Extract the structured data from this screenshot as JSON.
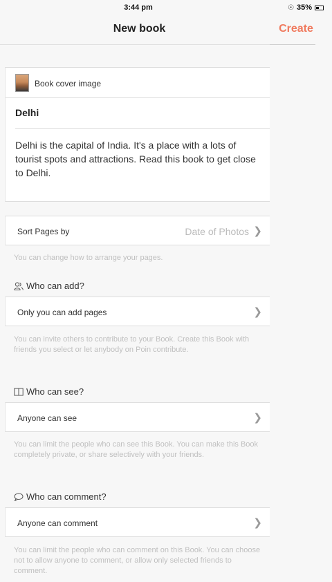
{
  "status_bar": {
    "time": "3:44 pm",
    "battery": "35%"
  },
  "nav": {
    "title": "New book",
    "create_label": "Create"
  },
  "book": {
    "cover_label": "Book cover image",
    "title": "Delhi",
    "description": "Delhi is the capital of India. It's a place with a lots of tourist spots and attractions. Read this book  to get close to Delhi."
  },
  "sort": {
    "label": "Sort Pages by",
    "value": "Date of Photos",
    "hint": "You can change how to arrange your pages."
  },
  "who_add": {
    "header": "Who can add?",
    "value": "Only you can add pages",
    "hint": "You can invite others to contribute to your Book. Create this Book with friends you select or let anybody on Poin contribute."
  },
  "who_see": {
    "header": "Who can see?",
    "value": "Anyone can see",
    "hint": "You can limit the people who can see this Book. You can make this Book completely private, or share selectively with your friends."
  },
  "who_comment": {
    "header": "Who can comment?",
    "value": "Anyone can comment",
    "hint": "You can limit the people who can comment on this Book. You can choose not to allow anyone to comment, or allow only selected friends to comment."
  },
  "colors": {
    "accent": "#f07a5e",
    "hint_text": "#c0c0c0",
    "background": "#f7f7f7"
  }
}
